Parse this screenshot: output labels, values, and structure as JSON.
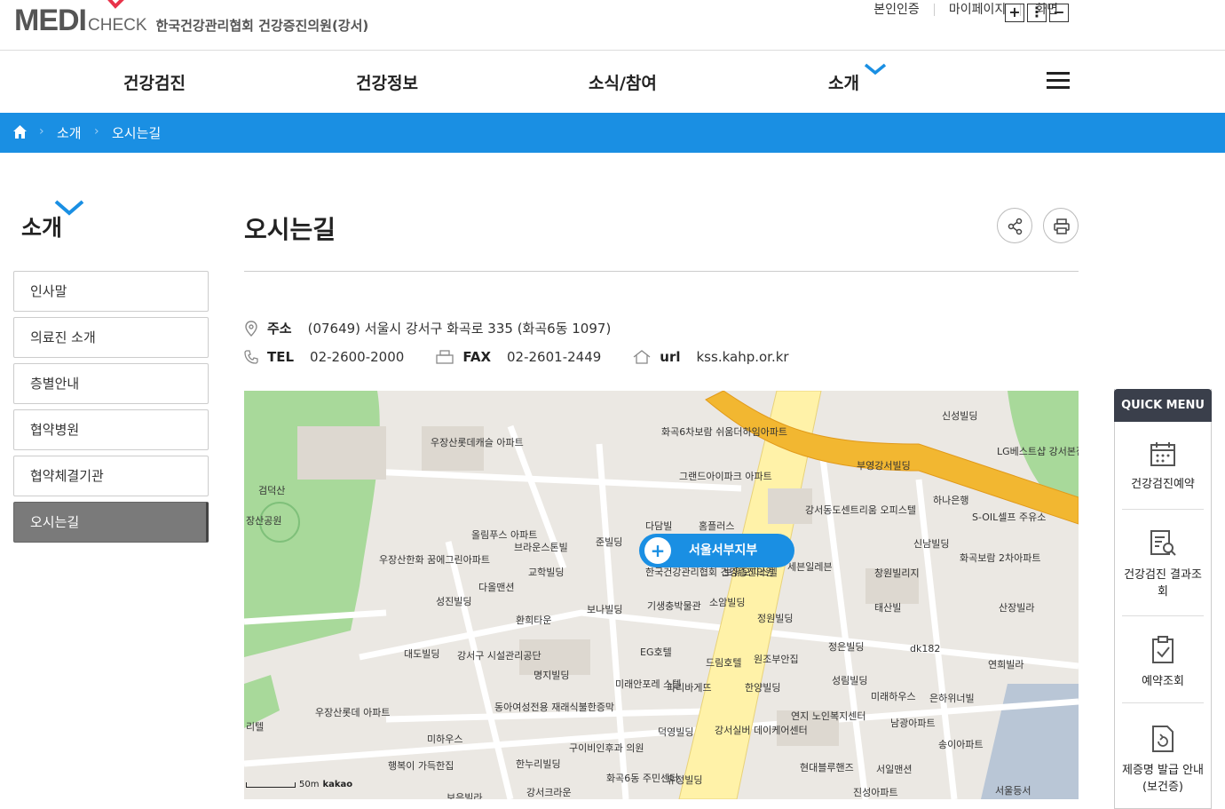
{
  "header": {
    "logo_main": "MEDI",
    "logo_sub": "CHECK",
    "org_name": "한국건강관리협회 건강증진의원(강서)",
    "util_links": [
      "본인인증",
      "마이페이지",
      "화면"
    ],
    "zoom_buttons": [
      "+",
      "⋮",
      "−"
    ]
  },
  "gnb": {
    "items": [
      "건강검진",
      "건강정보",
      "소식/참여",
      "소개"
    ]
  },
  "breadcrumb": {
    "items": [
      "소개",
      "오시는길"
    ]
  },
  "sidebar": {
    "title": "소개",
    "items": [
      "인사말",
      "의료진 소개",
      "층별안내",
      "협약병원",
      "협약체결기관",
      "오시는길"
    ],
    "active_index": 5
  },
  "page": {
    "title": "오시는길",
    "address_label": "주소",
    "address": "(07649)   서울시 강서구 화곡로 335 (화곡6동 1097)",
    "tel_label": "TEL",
    "tel": "02-2600-2000",
    "fax_label": "FAX",
    "fax": "02-2601-2449",
    "url_label": "url",
    "url": "kss.kahp.or.kr"
  },
  "map": {
    "marker_label": "서울서부지부",
    "scale": "50m",
    "provider": "kakao",
    "labels": [
      "화곡6차보람 쉬움더하임아파트",
      "우장산롯데캐슬 아파트",
      "그랜드아이파크 아파트",
      "강서동도센트리움 오피스텔",
      "신성빌딩",
      "LG베스트샵 강서본점",
      "부영강서빌딩",
      "하나은행",
      "S-OIL셀프 주유소",
      "검덕산",
      "장산공원",
      "올림푸스 아파트",
      "브라운스톤빌",
      "준빌딩",
      "다담빌",
      "홈플러스",
      "세븐일레븐",
      "신남빌딩",
      "창원빌리지",
      "화곡보람 2차아파트",
      "우장산한화 꿈에그린아파트",
      "교학빌딩",
      "다올맨션",
      "성진빌딩",
      "환희타운",
      "보나빌딩",
      "기생충박물관",
      "소암빌딩",
      "정원빌딩",
      "태산빌",
      "산장빌라",
      "대도빌딩",
      "강서구 시설관리공단",
      "EG호텔",
      "드림호텔",
      "원조부안집",
      "정은빌딩",
      "dk182",
      "연희빌라",
      "명지빌딩",
      "미래안포레 스텔",
      "파리바게뜨",
      "한양빌딩",
      "성림빌딩",
      "미래하우스",
      "은하위너빌",
      "우장산롯데 아파트",
      "동아여성전용 재래식불한증막",
      "덕영빌딩",
      "강서실버 데이케어센터",
      "연지 노인복지센터",
      "남광아파트",
      "송이아파트",
      "미하우스",
      "구이비인후과 의원",
      "한누리빌딩",
      "행복이 가득한집",
      "화곡6동 주민센터",
      "유정빌딩",
      "현대블루핸즈",
      "서일맨션",
      "진성아파트",
      "강서크라운",
      "보은빌라",
      "서울등서",
      "리텔",
      "한국건강관리협회 건강증진의원",
      "보유오피스텔"
    ]
  },
  "quick_menu": {
    "title": "QUICK MENU",
    "items": [
      "건강검진예약",
      "건강검진 결과조회",
      "예약조회",
      "제증명 발급 안내 (보건증)"
    ]
  }
}
